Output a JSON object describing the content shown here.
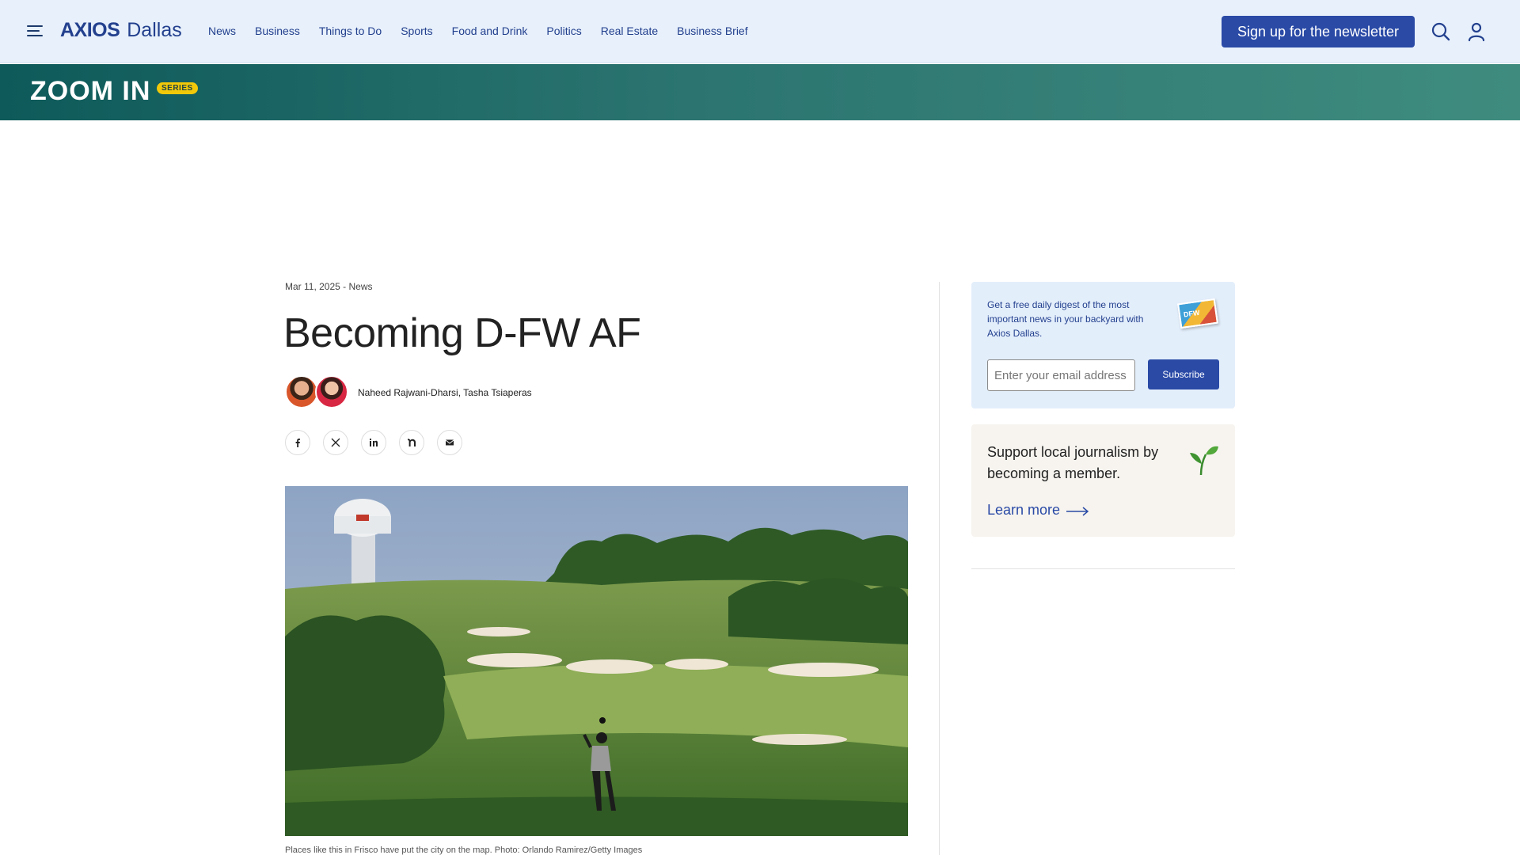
{
  "nav": {
    "brand": "AXIOS",
    "city": "Dallas",
    "links": [
      "News",
      "Business",
      "Things to Do",
      "Sports",
      "Food and Drink",
      "Politics",
      "Real Estate",
      "Business Brief"
    ],
    "signup_label": "Sign up for the newsletter"
  },
  "banner": {
    "title": "ZOOM IN",
    "badge": "SERIES"
  },
  "article": {
    "meta": "Mar 11, 2025 - News",
    "headline": "Becoming D-FW AF",
    "authors": "Naheed Rajwani-Dharsi, Tasha Tsiaperas",
    "share_icons": [
      "facebook-icon",
      "x-icon",
      "linkedin-icon",
      "nextdoor-icon",
      "email-icon"
    ],
    "caption": "Places like this in Frisco have put the city on the map. Photo: Orlando Ramirez/Getty Images"
  },
  "sidebar": {
    "newsletter_text": "Get a free daily digest of the most important news in your backyard with Axios Dallas.",
    "email_placeholder": "Enter your email address",
    "subscribe_label": "Subscribe",
    "member_text": "Support local journalism by becoming a member.",
    "learn_more_label": "Learn more"
  },
  "colors": {
    "nav_bg": "#e7f0fb",
    "brand_blue": "#23408e",
    "button_blue": "#2a4aa6",
    "banner_teal": "#2b7470",
    "badge_yellow": "#f1c90a"
  }
}
